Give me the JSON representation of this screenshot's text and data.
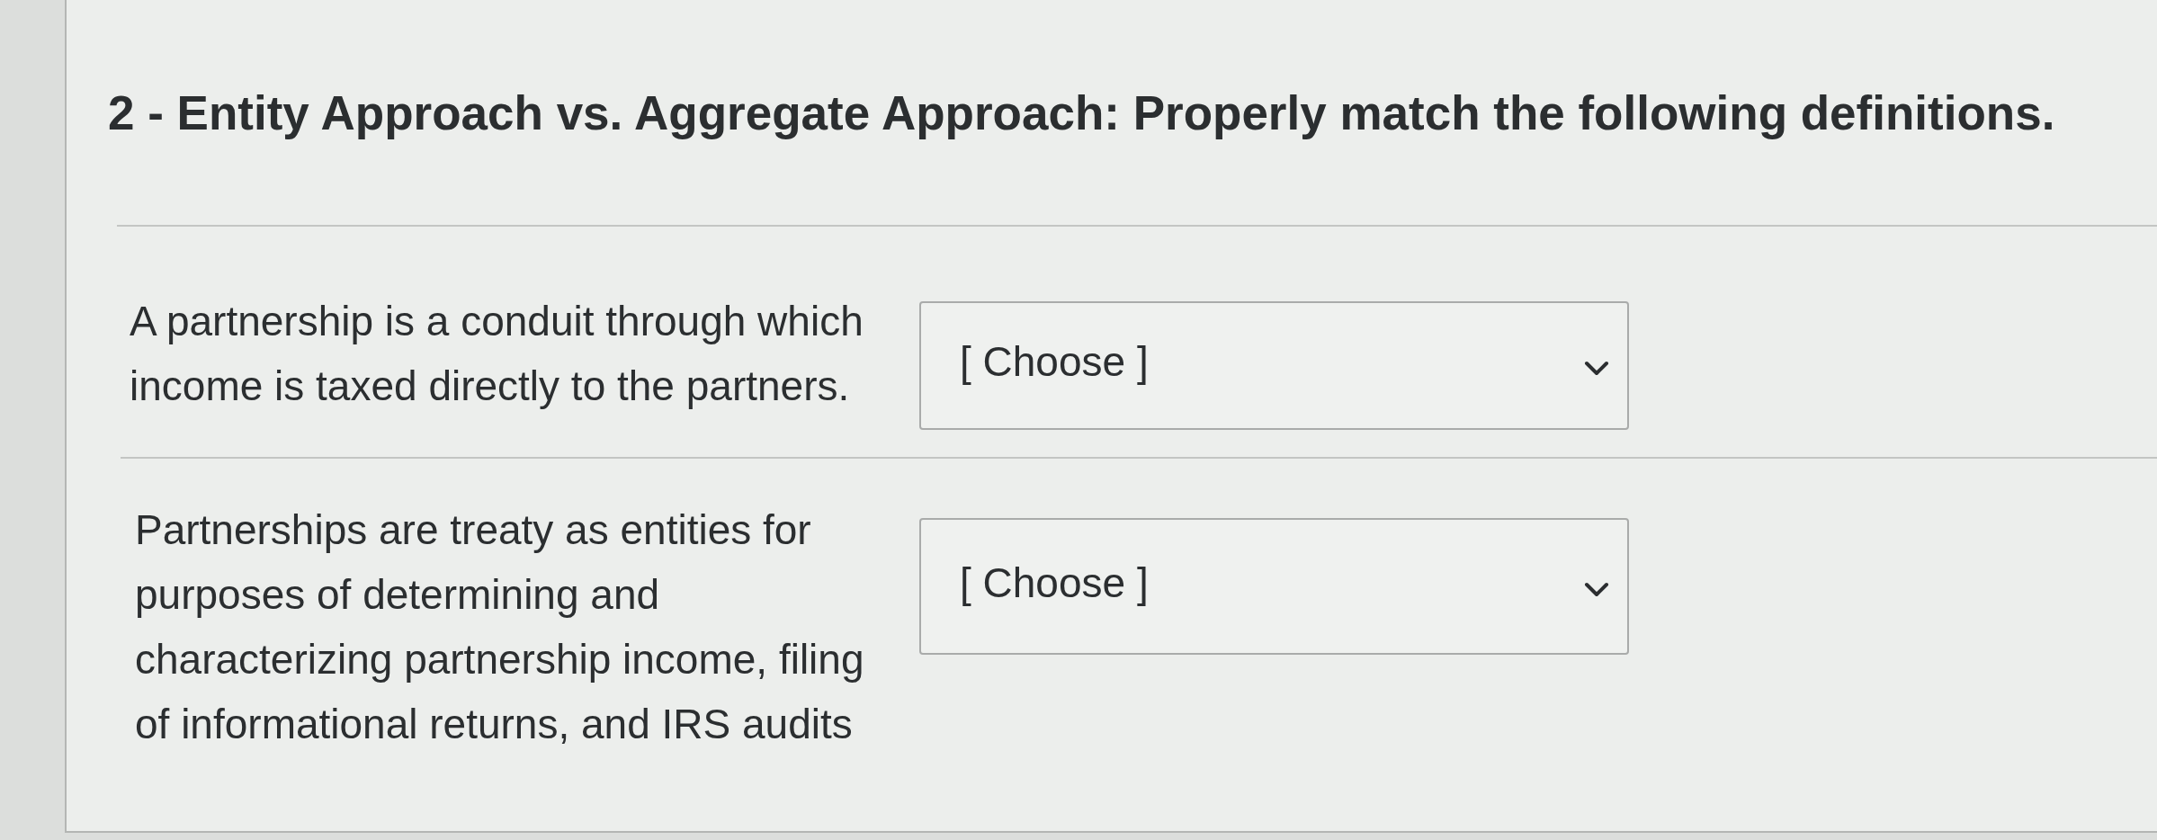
{
  "question": {
    "title": "2 - Entity Approach vs. Aggregate Approach: Properly match the following definitions."
  },
  "matches": [
    {
      "prompt": "A partnership is a conduit through which income is taxed directly to the partners.",
      "answer": {
        "value": "[ Choose ]"
      }
    },
    {
      "prompt": "Partnerships are treaty as entities for purposes of determining and characterizing partnership income, filing of informational returns, and IRS audits",
      "answer": {
        "value": "[ Choose ]"
      }
    }
  ]
}
